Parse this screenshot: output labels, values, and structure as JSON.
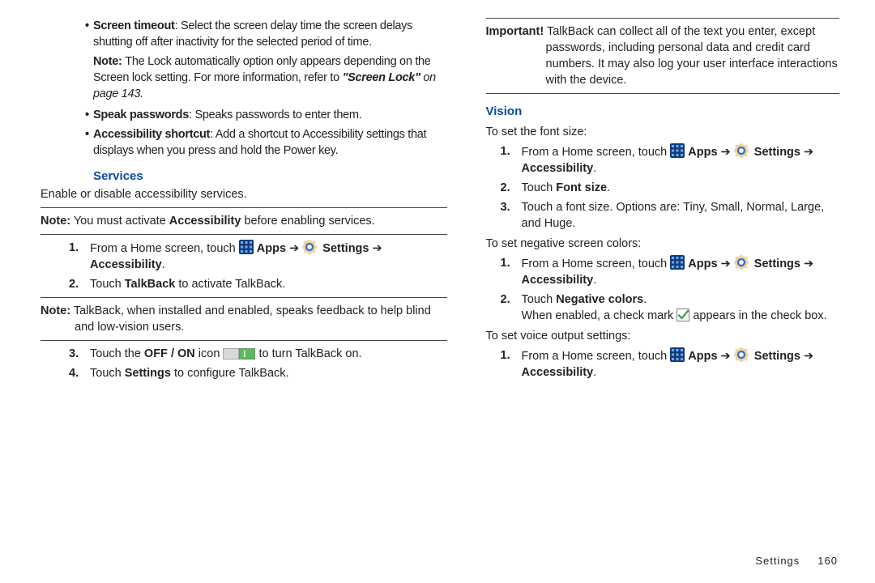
{
  "left": {
    "bullets": {
      "screen_timeout_label": "Screen timeout",
      "screen_timeout_text": ": Select the screen delay time the screen delays shutting off after inactivity for the selected period of time.",
      "note1_prefix": "Note: ",
      "note1_text": "The Lock automatically option only appears depending on the Screen lock setting. For more information, refer to ",
      "note1_ref": "\"Screen Lock\"",
      "note1_page": " on page 143.",
      "speak_pw_label": "Speak passwords",
      "speak_pw_text": ": Speaks passwords to enter them.",
      "a11y_shortcut_label": "Accessibility shortcut",
      "a11y_shortcut_text": ": Add a shortcut to Accessibility settings that displays when you press and hold the Power key."
    },
    "services_heading": "Services",
    "services_desc": "Enable or disable accessibility services.",
    "services_note_prefix": "Note:",
    "services_note_text_a": " You must activate ",
    "services_note_bold": "Accessibility",
    "services_note_text_b": " before enabling services.",
    "step1_a": "From a Home screen, touch ",
    "apps_label": "Apps",
    "arrow": " ➔ ",
    "settings_label": "Settings",
    "a11y_label": "Accessibility",
    "step2_a": "Touch ",
    "step2_bold": "TalkBack",
    "step2_b": " to activate TalkBack.",
    "talkback_note_prefix": "Note:",
    "talkback_note_text": " TalkBack, when installed and enabled, speaks feedback to help blind and low-vision users.",
    "step3_a": "Touch the ",
    "step3_bold": "OFF / ON",
    "step3_b": " icon ",
    "step3_c": " to turn TalkBack on.",
    "step4_a": "Touch ",
    "step4_bold": "Settings",
    "step4_b": " to configure TalkBack."
  },
  "right": {
    "important_prefix": "Important!",
    "important_text": " TalkBack can collect all of the text you enter, except passwords, including personal data and credit card numbers. It may also log your user interface interactions with the device.",
    "vision_heading": "Vision",
    "font_intro": "To set the font size:",
    "step1_a": "From a Home screen, touch ",
    "apps_label": "Apps",
    "arrow": " ➔ ",
    "settings_label": "Settings",
    "a11y_label": "Accessibility",
    "font_step2_a": "Touch ",
    "font_step2_bold": "Font size",
    "font_step3": "Touch a font size. Options are: Tiny, Small, Normal, Large, and Huge.",
    "neg_intro": "To set negative screen colors:",
    "neg_step2_a": "Touch ",
    "neg_step2_bold": "Negative colors",
    "neg_step2_c": ".",
    "neg_step2_d_a": "When enabled, a check mark ",
    "neg_step2_d_b": " appears in the check box.",
    "voice_intro": "To set voice output settings:"
  },
  "footer": {
    "section": "Settings",
    "page": "160"
  }
}
